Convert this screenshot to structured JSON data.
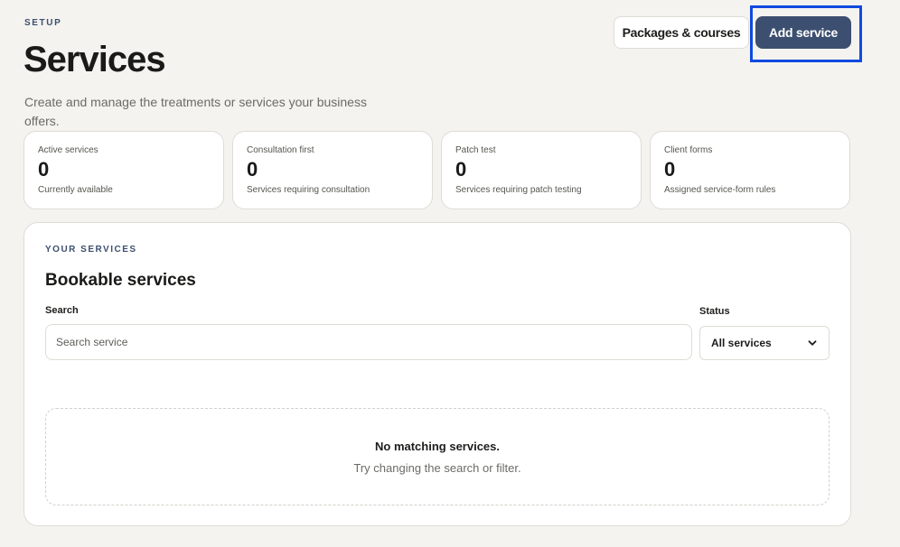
{
  "header": {
    "eyebrow": "SETUP",
    "title": "Services",
    "description": "Create and manage the treatments or services your business offers."
  },
  "actions": {
    "packages_label": "Packages & courses",
    "add_label": "Add service"
  },
  "stats": [
    {
      "label": "Active services",
      "value": "0",
      "sub": "Currently available"
    },
    {
      "label": "Consultation first",
      "value": "0",
      "sub": "Services requiring consultation"
    },
    {
      "label": "Patch test",
      "value": "0",
      "sub": "Services requiring patch testing"
    },
    {
      "label": "Client forms",
      "value": "0",
      "sub": "Assigned service-form rules"
    }
  ],
  "panel": {
    "eyebrow": "YOUR SERVICES",
    "title": "Bookable services",
    "search_label": "Search",
    "search_placeholder": "Search service",
    "search_value": "",
    "status_label": "Status",
    "status_selected": "All services",
    "empty_title": "No matching services.",
    "empty_sub": "Try changing the search or filter."
  },
  "colors": {
    "background": "#f4f3ef",
    "primary_button": "#3d4f70",
    "focus_ring": "#1149e0",
    "eyebrow": "#3d4f6e"
  }
}
